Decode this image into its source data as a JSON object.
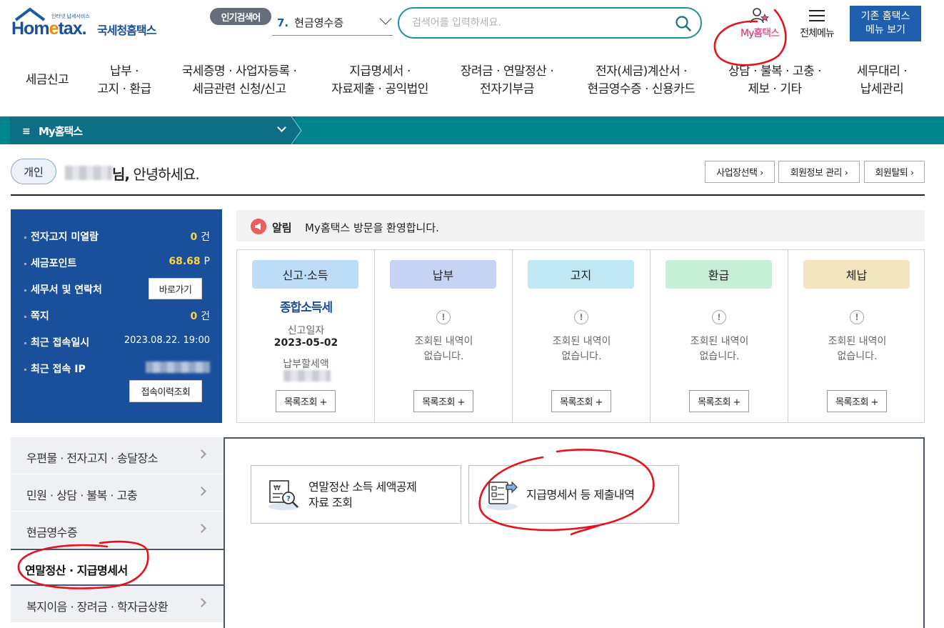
{
  "header": {
    "logo_small": "인터넷 납세서비스",
    "logo_main_a": "Hom",
    "logo_main_b": "e",
    "logo_main_c": "tax.",
    "logo_sub": "국세청홈택스",
    "popular_badge": "인기검색어",
    "popular_num": "7.",
    "popular_term": "현금영수증",
    "search_placeholder": "검색어를 입력하세요.",
    "my_hometax": "My홈택스",
    "all_menu": "전체메뉴",
    "old_menu_btn": "기존 홈택스\n메뉴 보기"
  },
  "gnb": [
    {
      "label": "세금신고"
    },
    {
      "label": "납부 ·\n고지 · 환급"
    },
    {
      "label": "국세증명 · 사업자등록 ·\n세금관련 신청/신고"
    },
    {
      "label": "지급명세서 ·\n자료제출 · 공익법인"
    },
    {
      "label": "장려금 · 연말정산 ·\n전자기부금"
    },
    {
      "label": "전자(세금)계산서 ·\n현금영수증 · 신용카드"
    },
    {
      "label": "상담 · 불복 · 고충 ·\n제보 · 기타"
    },
    {
      "label": "세무대리 ·\n납세관리"
    }
  ],
  "myhtx_bar": {
    "hamburger": "≡",
    "label": "My홈택스"
  },
  "greeting": {
    "type_badge": "개인",
    "name_suffix": "님,",
    "text": " 안녕하세요.",
    "buttons": [
      "사업장선택 ›",
      "회원정보 관리 ›",
      "회원탈퇴 ›"
    ]
  },
  "info_panel": {
    "rows": [
      {
        "label": "전자고지 미열람",
        "value": "0",
        "unit": "건"
      },
      {
        "label": "세금포인트",
        "value": "68.68",
        "unit": "P"
      },
      {
        "label": "세무서 및 연락처",
        "button": "바로가기"
      },
      {
        "label": "쪽지",
        "value": "0",
        "unit": "건"
      },
      {
        "label": "최근 접속일시",
        "plain": "2023.08.22.  19:00"
      },
      {
        "label": "최근 접속 IP"
      }
    ],
    "history_button": "접속이력조회"
  },
  "notice": {
    "label": "알림",
    "text": "My홈택스 방문을 환영합니다."
  },
  "status": {
    "columns": [
      {
        "title": "신고·소득",
        "color": "#bddcf7"
      },
      {
        "title": "납부",
        "color": "#c7d3f4"
      },
      {
        "title": "고지",
        "color": "#bfe8f4"
      },
      {
        "title": "환급",
        "color": "#c7eed6"
      },
      {
        "title": "체납",
        "color": "#f3e6bf"
      }
    ],
    "report": {
      "tax_name": "종합소득세",
      "date_label": "신고일자",
      "date_value": "2023-05-02",
      "amount_label": "납부할세액"
    },
    "empty_icon": "!",
    "empty_text": "조회된 내역이\n없습니다.",
    "list_button": "목록조회 +"
  },
  "side_menu": [
    {
      "label": "우편물 · 전자고지 · 송달장소"
    },
    {
      "label": "민원 · 상담 · 불복 · 고충"
    },
    {
      "label": "현금영수증"
    },
    {
      "label": "연말정산 · 지급명세서"
    },
    {
      "label": "복지이음 · 장려금 · 학자금상환"
    }
  ],
  "content_cards": [
    {
      "label": "연말정산 소득 세액공제\n자료 조회",
      "icon": "won-document-search-icon"
    },
    {
      "label": "지급명세서 등 제출내역",
      "icon": "document-send-icon"
    }
  ],
  "colors": {
    "brand_blue": "#1a4f9c",
    "teal": "#00858f",
    "annotation_red": "#e8101a"
  }
}
